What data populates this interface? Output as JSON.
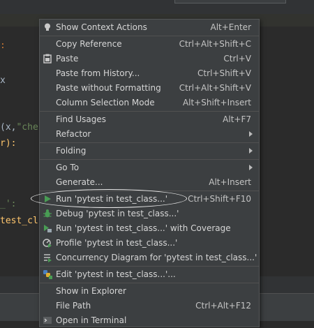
{
  "code": {
    "line1": "x",
    "line2": "(x,\"chec",
    "line3": "r):",
    "line4": "_':",
    "line5": "test_cl"
  },
  "menu": {
    "show_context_actions": {
      "label": "Show Context Actions",
      "shortcut": "Alt+Enter"
    },
    "copy_reference": {
      "label": "Copy Reference",
      "shortcut": "Ctrl+Alt+Shift+C"
    },
    "paste": {
      "label": "Paste",
      "shortcut": "Ctrl+V"
    },
    "paste_from_history": {
      "label": "Paste from History...",
      "shortcut": "Ctrl+Shift+V"
    },
    "paste_without_formatting": {
      "label": "Paste without Formatting",
      "shortcut": "Ctrl+Alt+Shift+V"
    },
    "column_selection_mode": {
      "label": "Column Selection Mode",
      "shortcut": "Alt+Shift+Insert"
    },
    "find_usages": {
      "label": "Find Usages",
      "shortcut": "Alt+F7"
    },
    "refactor": {
      "label": "Refactor"
    },
    "folding": {
      "label": "Folding"
    },
    "go_to": {
      "label": "Go To"
    },
    "generate": {
      "label": "Generate...",
      "shortcut": "Alt+Insert"
    },
    "run": {
      "label": "Run 'pytest in test_class...'",
      "shortcut": "Ctrl+Shift+F10"
    },
    "debug": {
      "label": "Debug 'pytest in test_class...'"
    },
    "run_coverage": {
      "label": "Run 'pytest in test_class...' with Coverage"
    },
    "profile": {
      "label": "Profile 'pytest in test_class...'"
    },
    "concurrency": {
      "label": "Concurrency Diagram for 'pytest in test_class...'"
    },
    "edit": {
      "label": "Edit 'pytest in test_class...'..."
    },
    "show_in_explorer": {
      "label": "Show in Explorer"
    },
    "file_path": {
      "label": "File Path",
      "shortcut": "Ctrl+Alt+F12"
    },
    "open_in_terminal": {
      "label": "Open in Terminal"
    }
  },
  "icons": {
    "show_context_actions": "bulb-icon",
    "paste": "clipboard-icon",
    "run": "run-triangle-icon",
    "debug": "bug-icon",
    "run_coverage": "coverage-icon",
    "profile": "profiler-icon",
    "concurrency": "concurrency-icon",
    "edit": "python-config-icon",
    "open_in_terminal": "terminal-icon"
  },
  "colors": {
    "menu_bg": "#3c3f41",
    "text": "#d6d6d6",
    "run_green": "#499c54",
    "bulb": "#c9c9c9"
  }
}
